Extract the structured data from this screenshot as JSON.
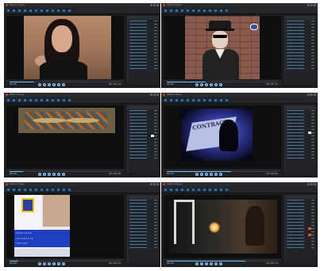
{
  "panels": [
    {
      "title": "Media Player",
      "start": "00:00",
      "time": "00:02:14",
      "progress": 0.22
    },
    {
      "title": "Media Player",
      "start": "00:00",
      "time": "00:01:37",
      "progress": 0.35
    },
    {
      "title": "Media Player",
      "start": "00:00",
      "time": "00:00:48",
      "progress": 0.12
    },
    {
      "title": "Media Player",
      "start": "00:00",
      "time": "00:03:05",
      "progress": 0.58
    },
    {
      "title": "Media Player",
      "start": "00:00",
      "time": "00:00:21",
      "progress": 0.08
    },
    {
      "title": "Media Player",
      "start": "00:00",
      "time": "00:04:12",
      "progress": 0.71
    }
  ],
  "videos": {
    "contract_text": "CONTRACT",
    "flyer_lines": [
      "•••••  •••••",
      "••• ••••• ••",
      "•••• •••"
    ]
  },
  "colors": {
    "pane_bg": "#1b1c1e",
    "accent": "#2d74b8",
    "seek": "#7cc0ff"
  },
  "icons": [
    "play-icon",
    "pause-icon",
    "stop-icon",
    "prev-icon",
    "next-icon",
    "volume-icon"
  ]
}
